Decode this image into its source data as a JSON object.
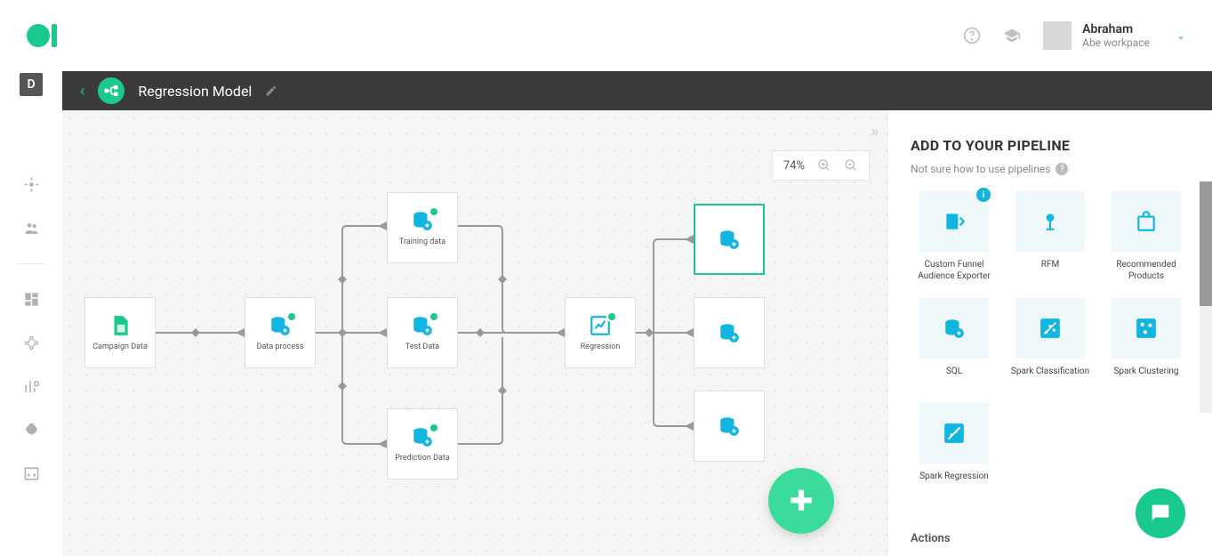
{
  "header": {
    "user_name": "Abraham",
    "workspace": "Abe workpace"
  },
  "sidenav": {
    "active_letter": "D"
  },
  "breadcrumb": {
    "title": "Regression Model"
  },
  "zoom": {
    "level": "74%"
  },
  "nodes": {
    "campaign": "Campaign Data",
    "process": "Data process",
    "training": "Training data",
    "test": "Test Data",
    "prediction": "Prediction Data",
    "regression": "Regression"
  },
  "panel": {
    "title": "ADD TO YOUR PIPELINE",
    "subtitle": "Not sure how to use pipelines",
    "actions_label": "Actions",
    "tiles": [
      {
        "label": "Custom Funnel Audience Exporter"
      },
      {
        "label": "RFM"
      },
      {
        "label": "Recommended Products"
      },
      {
        "label": "SQL"
      },
      {
        "label": "Spark Classification"
      },
      {
        "label": "Spark Clustering"
      },
      {
        "label": "Spark Regression"
      }
    ]
  }
}
